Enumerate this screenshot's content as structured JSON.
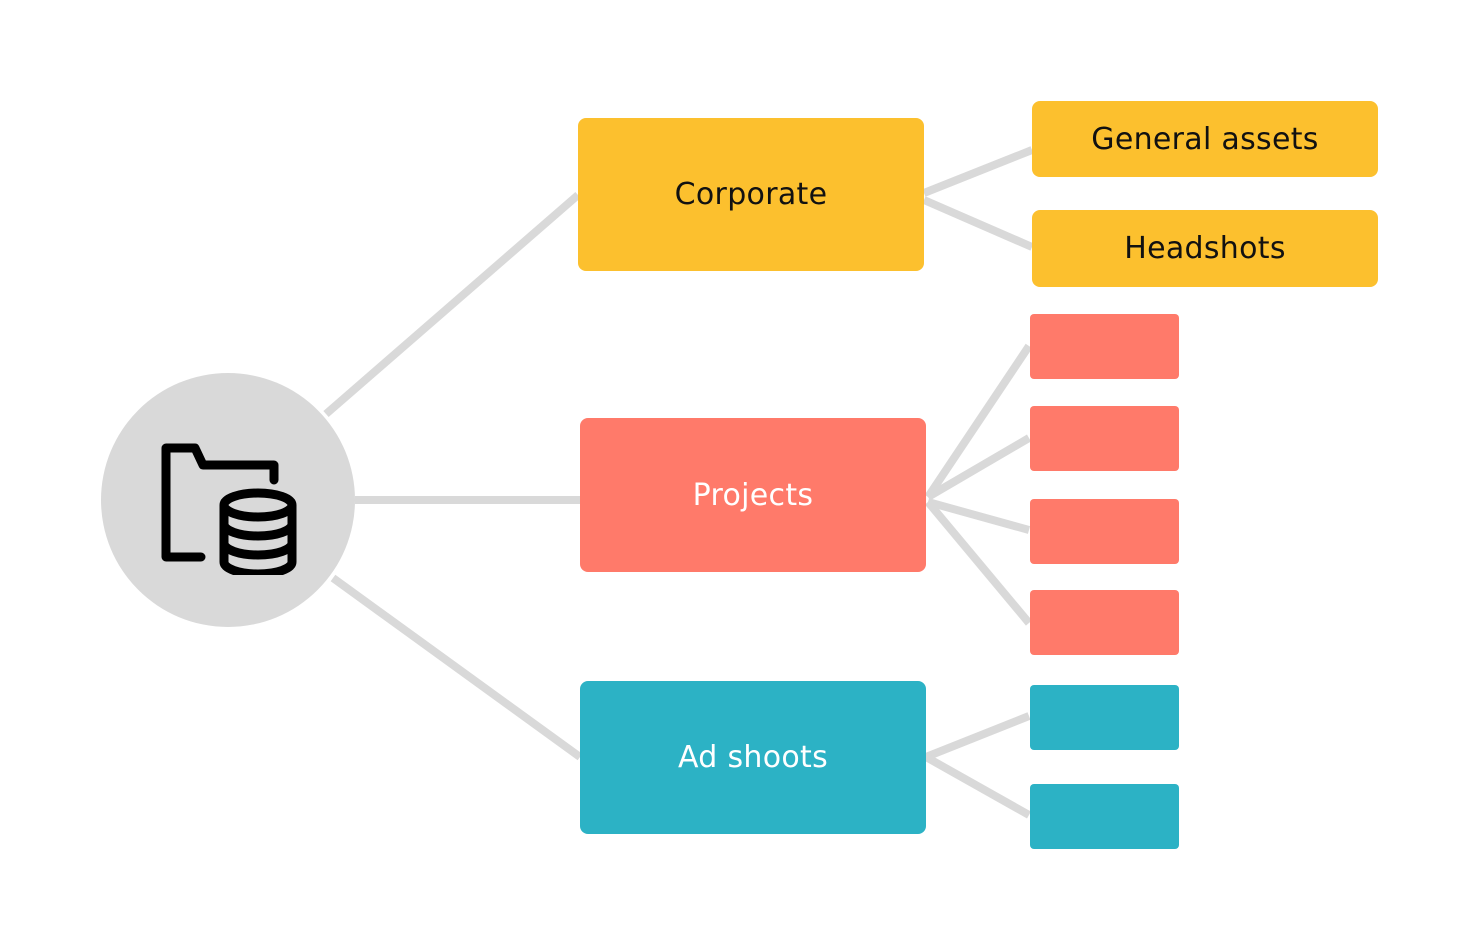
{
  "diagram": {
    "type": "tree",
    "root": {
      "icon": "folder-database-icon",
      "label": ""
    },
    "colors": {
      "connector": "#d9d9d9",
      "root_fill": "#d9d9d9",
      "corporate": "#fcc02e",
      "projects": "#ff7a6a",
      "ad_shoots": "#2cb2c5",
      "dark_text": "#111111",
      "light_text": "#ffffff"
    },
    "branches": [
      {
        "id": "corporate",
        "label": "Corporate",
        "children": [
          {
            "label": "General assets"
          },
          {
            "label": "Headshots"
          }
        ]
      },
      {
        "id": "projects",
        "label": "Projects",
        "children": [
          {
            "label": ""
          },
          {
            "label": ""
          },
          {
            "label": ""
          },
          {
            "label": ""
          }
        ]
      },
      {
        "id": "ad_shoots",
        "label": "Ad shoots",
        "children": [
          {
            "label": ""
          },
          {
            "label": ""
          }
        ]
      }
    ]
  }
}
